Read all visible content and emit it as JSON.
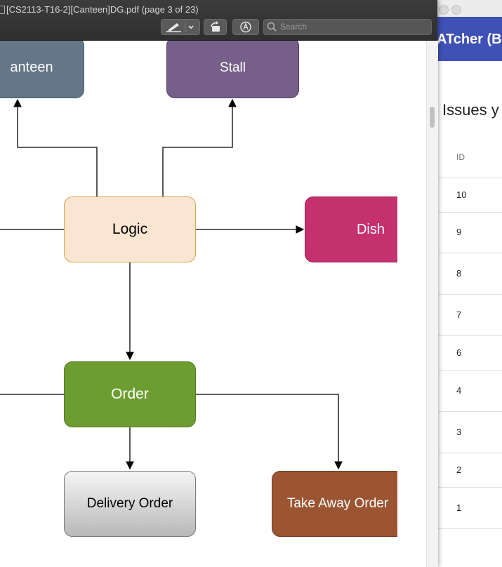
{
  "preview": {
    "title": "[CS2113-T16-2][Canteen]DG.pdf (page 3 of 23)",
    "search_placeholder": "Search"
  },
  "diagram": {
    "nodes": {
      "canteen": "anteen",
      "stall": "Stall",
      "logic": "Logic",
      "dish": "Dish",
      "order": "Order",
      "delivery_order": "Delivery Order",
      "take_away_order": "Take Away Order"
    },
    "colors": {
      "canteen": "#647687",
      "stall": "#76608a",
      "logic": "#fae5d3",
      "dish": "#c5306e",
      "order": "#6d9d31",
      "delivery_order": "#e9e9e9",
      "take_away_order": "#9b5533"
    }
  },
  "catcher": {
    "app_title": "ATcher  (B",
    "issues_heading": "Issues y",
    "table": {
      "id_header": "ID",
      "ids": [
        "10",
        "9",
        "8",
        "7",
        "6",
        "4",
        "3",
        "2",
        "1"
      ]
    },
    "colors": {
      "app_bar": "#3f51b5"
    }
  }
}
